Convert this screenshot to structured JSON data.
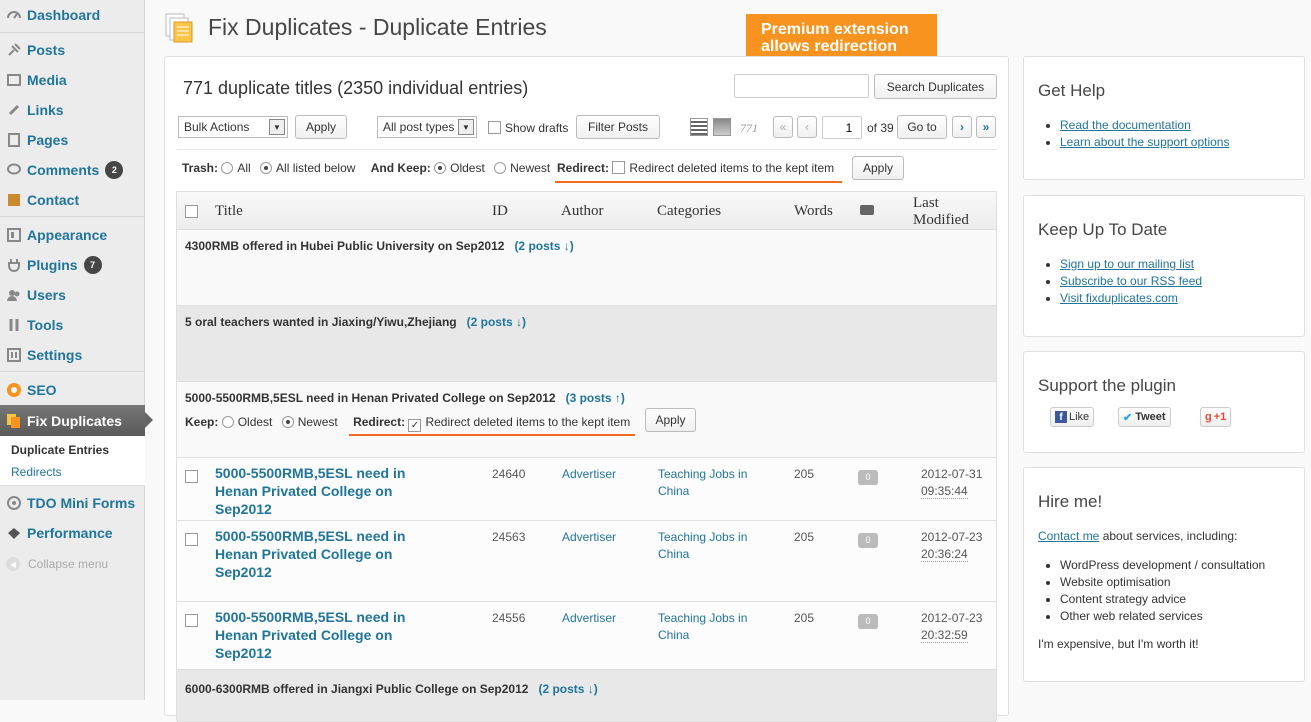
{
  "sidebar": {
    "dashboard": "Dashboard",
    "posts": "Posts",
    "media": "Media",
    "links": "Links",
    "pages": "Pages",
    "comments": "Comments",
    "comments_badge": "2",
    "contact": "Contact",
    "appearance": "Appearance",
    "plugins": "Plugins",
    "plugins_badge": "7",
    "users": "Users",
    "tools": "Tools",
    "settings": "Settings",
    "seo": "SEO",
    "fix_duplicates": "Fix Duplicates",
    "sub_duplicate_entries": "Duplicate Entries",
    "sub_redirects": "Redirects",
    "tdo": "TDO Mini Forms",
    "performance": "Performance",
    "collapse": "Collapse menu"
  },
  "page": {
    "title": "Fix Duplicates - Duplicate Entries",
    "callout": "Premium extension allows redirection",
    "summary": "771 duplicate titles (2350 individual entries)"
  },
  "toolbar": {
    "search_value": "",
    "search_button": "Search Duplicates",
    "bulk_actions": "Bulk Actions",
    "apply": "Apply",
    "post_types": "All post types",
    "show_drafts": "Show drafts",
    "filter_posts": "Filter Posts",
    "count": "771",
    "page_first": "«",
    "page_prev": "‹",
    "page_value": "1",
    "page_of": "of 39",
    "goto": "Go to",
    "page_next": "›",
    "page_last": "»"
  },
  "options": {
    "trash_label": "Trash:",
    "trash_all": "All",
    "trash_listed": "All listed below",
    "keep_label": "And Keep:",
    "keep_oldest": "Oldest",
    "keep_newest": "Newest",
    "redirect_label": "Redirect:",
    "redirect_text": "Redirect deleted items to the kept item",
    "apply": "Apply"
  },
  "table": {
    "headers": {
      "title": "Title",
      "id": "ID",
      "author": "Author",
      "categories": "Categories",
      "words": "Words",
      "modified_1": "Last",
      "modified_2": "Modified"
    },
    "groups": [
      {
        "title": "4300RMB offered in Hubei Public University on Sep2012",
        "count": "(2 posts ↓)"
      },
      {
        "title": "5 oral teachers wanted in Jiaxing/Yiwu,Zhejiang",
        "count": "(2 posts ↓)"
      },
      {
        "title": "5000-5500RMB,5ESL need in Henan Privated College on Sep2012",
        "count": "(3 posts ↑)"
      },
      {
        "title": "6000-6300RMB offered in Jiangxi Public College on Sep2012",
        "count": "(2 posts ↓)"
      }
    ],
    "group_keep": {
      "keep_label": "Keep:",
      "oldest": "Oldest",
      "newest": "Newest",
      "redirect_label": "Redirect:",
      "redirect_text": "Redirect deleted items to the kept item",
      "apply": "Apply"
    },
    "rows": [
      {
        "title": "5000-5500RMB,5ESL need in Henan Privated College on Sep2012",
        "id": "24640",
        "author": "Advertiser",
        "category": "Teaching Jobs in China",
        "words": "205",
        "comments": "0",
        "date": "2012-07-31",
        "time": "09:35:44"
      },
      {
        "title": "5000-5500RMB,5ESL need in Henan Privated College on Sep2012",
        "id": "24563",
        "author": "Advertiser",
        "category": "Teaching Jobs in China",
        "words": "205",
        "comments": "0",
        "date": "2012-07-23",
        "time": "20:36:24"
      },
      {
        "title": "5000-5500RMB,5ESL need in Henan Privated College on Sep2012",
        "id": "24556",
        "author": "Advertiser",
        "category": "Teaching Jobs in China",
        "words": "205",
        "comments": "0",
        "date": "2012-07-23",
        "time": "20:32:59"
      }
    ]
  },
  "widgets": {
    "help": {
      "title": "Get Help",
      "links": [
        "Read the documentation",
        "Learn about the support options"
      ]
    },
    "update": {
      "title": "Keep Up To Date",
      "links": [
        "Sign up to our mailing list",
        "Subscribe to our RSS feed",
        "Visit fixduplicates.com"
      ]
    },
    "support": {
      "title": "Support the plugin",
      "like": "Like",
      "tweet": "Tweet",
      "plus": "+1"
    },
    "hire": {
      "title": "Hire me!",
      "contact": "Contact me",
      "intro": " about services, including:",
      "items": [
        "WordPress development / consultation",
        "Website optimisation",
        "Content strategy advice",
        "Other web related services"
      ],
      "footer": "I'm expensive, but I'm worth it!"
    }
  },
  "colors": {
    "accent": "#21759b",
    "callout": "#f7931e",
    "underline": "#f26c1f"
  }
}
